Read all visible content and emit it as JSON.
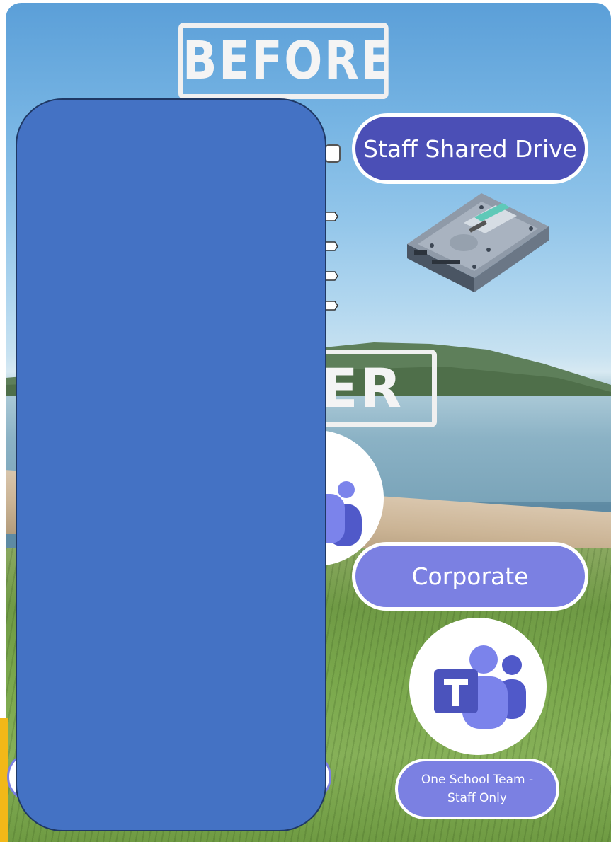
{
  "stamps": {
    "before": "BEFORE",
    "after_visible": "ER"
  },
  "labels": {
    "staff_shared_drive": "Staff Shared Drive",
    "corporate": "Corporate",
    "one_school_team_line1": "One School Team -",
    "one_school_team_line2": "Staff Only"
  },
  "icons": {
    "hard_drive": "hard-drive-icon",
    "teams": "microsoft-teams-icon",
    "teams_partial": "microsoft-teams-icon"
  },
  "colors": {
    "staff_pill": "#4b4fb6",
    "teams_pill": "#7b80e2",
    "redaction_box": "#4472c4",
    "accent_strip": "#f2b818"
  }
}
